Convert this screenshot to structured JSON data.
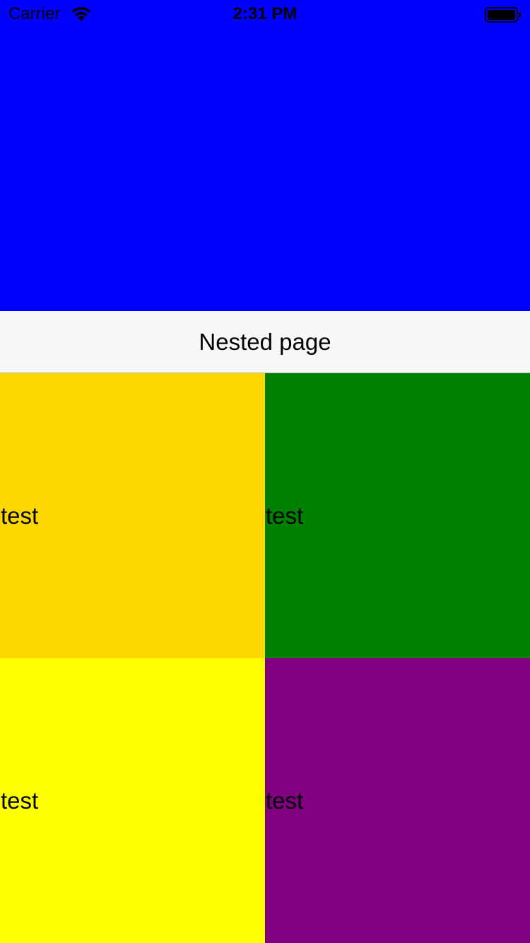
{
  "status_bar": {
    "carrier": "Carrier",
    "time": "2:31 PM",
    "icons": [
      "wifi-icon",
      "battery-icon"
    ]
  },
  "top_panel": {
    "color": "#0000ff"
  },
  "nav_bar": {
    "title": "Nested page",
    "background": "#f8f8f8"
  },
  "grid": {
    "cells": [
      {
        "label": "test",
        "color": "#ffd700"
      },
      {
        "label": "test",
        "color": "#008000"
      },
      {
        "label": "test",
        "color": "#ffff00"
      },
      {
        "label": "test",
        "color": "#800080"
      }
    ]
  }
}
